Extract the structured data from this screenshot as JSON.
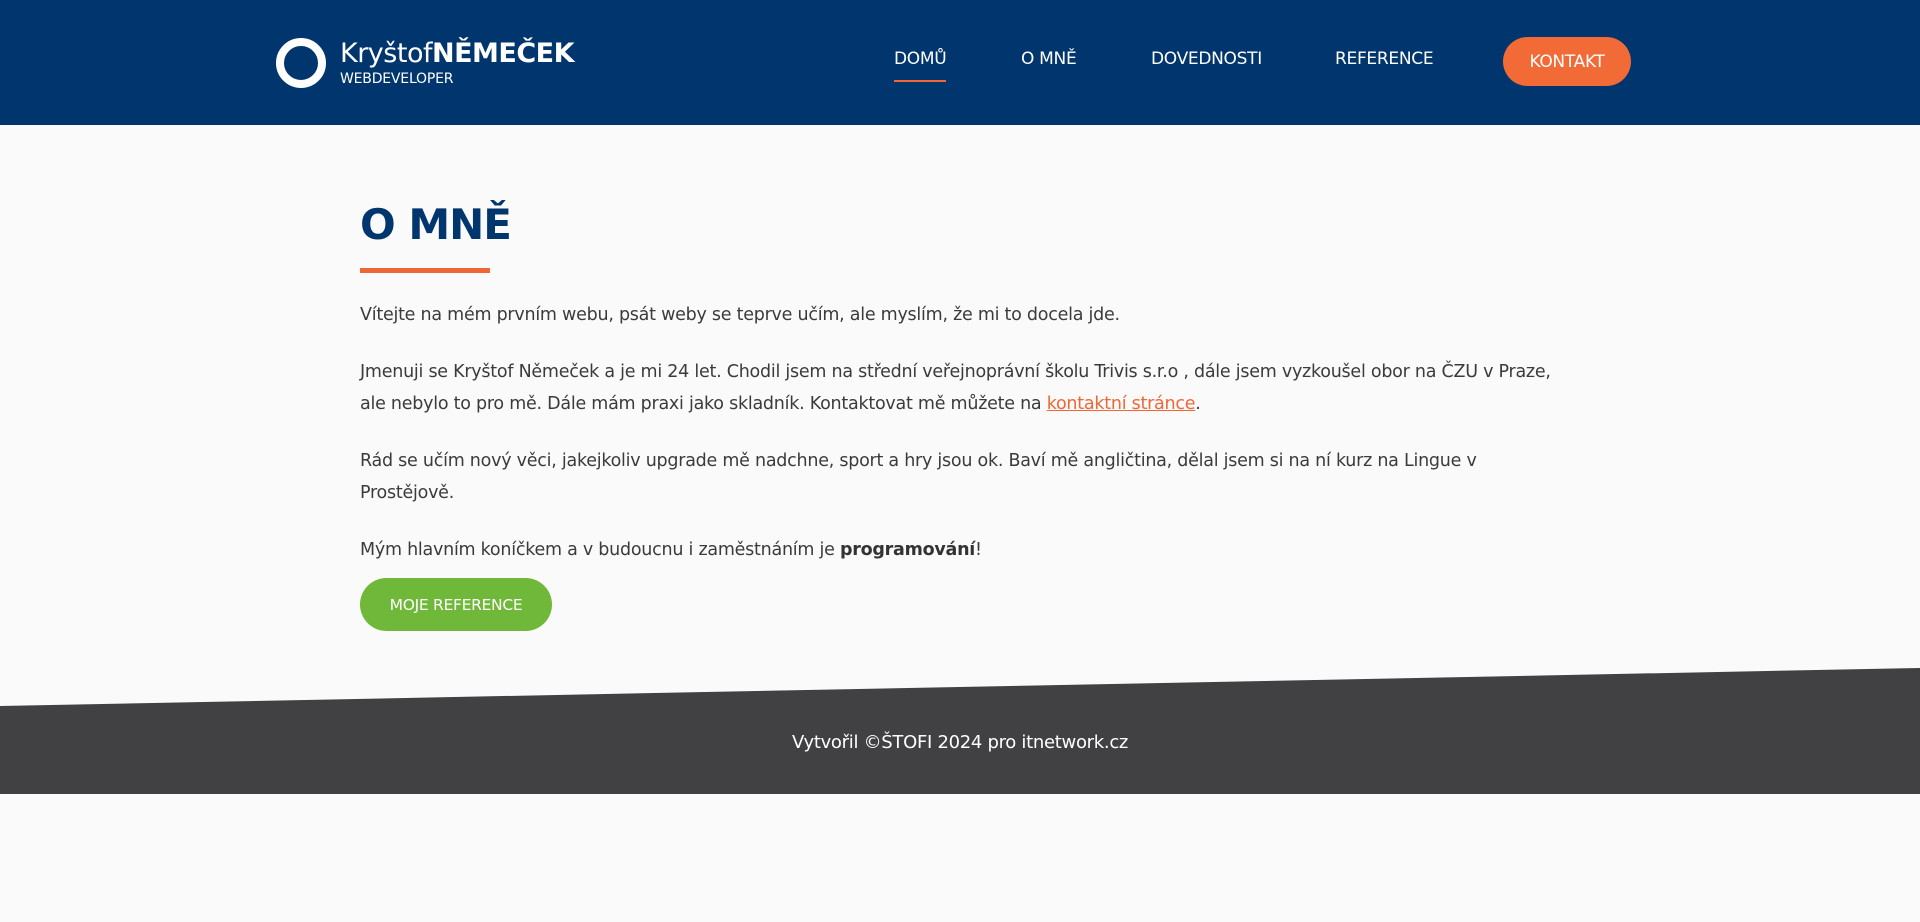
{
  "header": {
    "logo": {
      "name_first": "Kryštof",
      "name_last": "NĚMEČEK",
      "subtitle": "WEBDEVELOPER"
    },
    "nav": [
      {
        "label": "DOMŮ",
        "active": true
      },
      {
        "label": "O MNĚ",
        "active": false
      },
      {
        "label": "DOVEDNOSTI",
        "active": false
      },
      {
        "label": "REFERENCE",
        "active": false
      }
    ],
    "contact_label": "KONTAKT"
  },
  "main": {
    "title": "O MNĚ",
    "p1": "Vítejte na mém prvním webu, psát weby se teprve učím, ale myslím, že mi to docela jde.",
    "p2_line1": "Jmenuji se Kryštof Němeček a je mi 24 let. Chodil jsem na střední veřejnoprávní školu Trivis s.r.o , dále jsem vyzkoušel obor na ČZU v Praze,",
    "p2_line2_before": "ale nebylo to pro mě. Dále mám praxi jako skladník. Kontaktovat mě můžete na ",
    "p2_link": "kontaktní stránce",
    "p2_after": ".",
    "p3_line1": "Rád se učím nový věci, jakejkoliv upgrade mě nadchne, sport a hry jsou ok. Baví mě angličtina, dělal jsem si na ní kurz na Lingue v",
    "p3_line2": "Prostějově.",
    "p4_before": "Mým hlavním koníčkem a v budoucnu i zaměstnáním je ",
    "p4_strong": "programování",
    "p4_after": "!",
    "cta_label": "MOJE REFERENCE"
  },
  "footer": {
    "text": "Vytvořil ©ŠTOFI 2024 pro itnetwork.cz"
  },
  "colors": {
    "header_bg": "#00366d",
    "accent_orange": "#f26a36",
    "button_green": "#70b839",
    "footer_bg": "#414042",
    "page_bg": "#fafafa"
  },
  "icons": {
    "logo": "ring-logo-icon"
  }
}
